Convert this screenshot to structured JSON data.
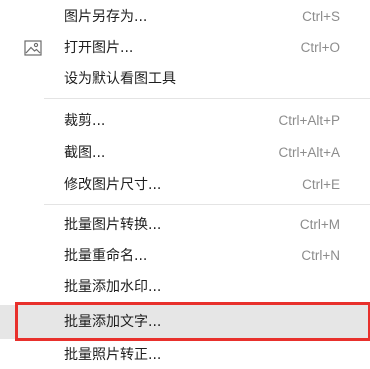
{
  "menu": {
    "items": [
      {
        "label": "图片另存为...",
        "shortcut": "Ctrl+S"
      },
      {
        "label": "打开图片...",
        "shortcut": "Ctrl+O",
        "icon": "image-icon"
      },
      {
        "label": "设为默认看图工具",
        "shortcut": ""
      },
      {
        "label": "裁剪...",
        "shortcut": "Ctrl+Alt+P"
      },
      {
        "label": "截图...",
        "shortcut": "Ctrl+Alt+A"
      },
      {
        "label": "修改图片尺寸...",
        "shortcut": "Ctrl+E"
      },
      {
        "label": "批量图片转换...",
        "shortcut": "Ctrl+M"
      },
      {
        "label": "批量重命名...",
        "shortcut": "Ctrl+N"
      },
      {
        "label": "批量添加水印...",
        "shortcut": ""
      },
      {
        "label": "批量添加文字...",
        "shortcut": "",
        "highlighted": true
      },
      {
        "label": "批量照片转正...",
        "shortcut": ""
      }
    ]
  },
  "colors": {
    "highlight_frame": "#e8302c",
    "hover_background": "#e6e6e6",
    "label_text": "#1e1e1e",
    "shortcut_text": "#8c8c8c"
  }
}
